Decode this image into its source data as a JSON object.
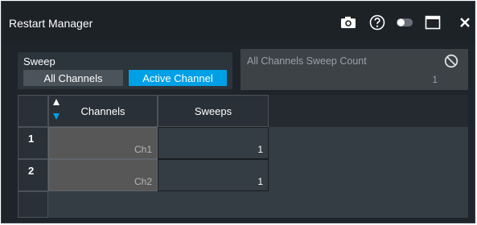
{
  "window": {
    "title": "Restart Manager",
    "icons": [
      "camera-icon",
      "help-icon",
      "toggle-icon",
      "maximize-icon",
      "close-icon"
    ]
  },
  "sweep": {
    "label": "Sweep",
    "options": [
      "All Channels",
      "Active Channel"
    ],
    "selected": "Active Channel"
  },
  "sweep_count": {
    "label": "All Channels Sweep Count",
    "value": "1",
    "icon": "disabled-icon"
  },
  "table": {
    "columns": [
      "Channels",
      "Sweeps"
    ],
    "rows": [
      {
        "num": "1",
        "channel": "Ch1",
        "sweeps": "1"
      },
      {
        "num": "2",
        "channel": "Ch2",
        "sweeps": "1"
      }
    ]
  },
  "colors": {
    "accent": "#00a0e6",
    "background": "#1f242a",
    "panel": "#2c343c"
  }
}
